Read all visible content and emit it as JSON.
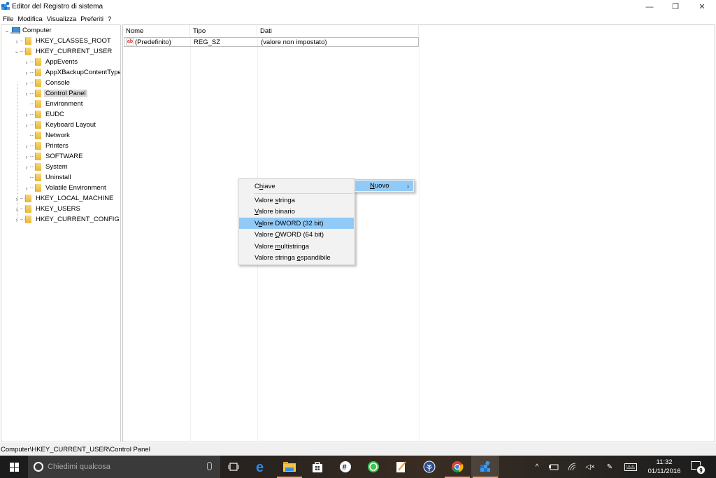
{
  "window": {
    "title": "Editor del Registro di sistema",
    "minimize_label": "—",
    "maximize_label": "❐",
    "close_label": "✕"
  },
  "menubar": {
    "items": [
      "File",
      "Modifica",
      "Visualizza",
      "Preferiti",
      "?"
    ]
  },
  "tree": {
    "root": "Computer",
    "hives": [
      {
        "label": "HKEY_CLASSES_ROOT",
        "expanded": false
      },
      {
        "label": "HKEY_CURRENT_USER",
        "expanded": true
      },
      {
        "label": "HKEY_LOCAL_MACHINE",
        "expanded": false
      },
      {
        "label": "HKEY_USERS",
        "expanded": false
      },
      {
        "label": "HKEY_CURRENT_CONFIG",
        "expanded": false
      }
    ],
    "hkcu_children": [
      {
        "label": "AppEvents",
        "has_children": true
      },
      {
        "label": "AppXBackupContentType",
        "has_children": true
      },
      {
        "label": "Console",
        "has_children": true
      },
      {
        "label": "Control Panel",
        "has_children": true,
        "selected": true
      },
      {
        "label": "Environment",
        "has_children": false
      },
      {
        "label": "EUDC",
        "has_children": true
      },
      {
        "label": "Keyboard Layout",
        "has_children": true
      },
      {
        "label": "Network",
        "has_children": false
      },
      {
        "label": "Printers",
        "has_children": true
      },
      {
        "label": "SOFTWARE",
        "has_children": true
      },
      {
        "label": "System",
        "has_children": true
      },
      {
        "label": "Uninstall",
        "has_children": false
      },
      {
        "label": "Volatile Environment",
        "has_children": true
      }
    ]
  },
  "list": {
    "columns": [
      "Nome",
      "Tipo",
      "Dati"
    ],
    "rows": [
      {
        "icon": "ab",
        "name": "(Predefinito)",
        "type": "REG_SZ",
        "data": "(valore non impostato)"
      }
    ]
  },
  "context_menu": {
    "parent_item": "Nuovo",
    "parent_accel": "N",
    "items": [
      {
        "label": "Chiave",
        "accel_index": 1
      },
      {
        "label": "Valore stringa",
        "accel_index": 7
      },
      {
        "label": "Valore binario",
        "accel_index": 0
      },
      {
        "label": "Valore DWORD (32 bit)",
        "accel_index": 1,
        "highlighted": true
      },
      {
        "label": "Valore QWORD (64 bit)",
        "accel_index": 7
      },
      {
        "label": "Valore multistringa",
        "accel_index": 7
      },
      {
        "label": "Valore stringa espandibile",
        "accel_index": 15
      }
    ]
  },
  "statusbar": {
    "path": "Computer\\HKEY_CURRENT_USER\\Control Panel"
  },
  "taskbar": {
    "search_placeholder": "Chiedimi qualcosa",
    "apps": [
      "task-view",
      "edge",
      "file-explorer",
      "store",
      "slack",
      "whatsapp",
      "notepad",
      "app-tree",
      "chrome",
      "regedit"
    ],
    "clock_time": "11:32",
    "clock_date": "01/11/2016",
    "notification_count": "9"
  },
  "colors": {
    "menu_highlight": "#91c9f7",
    "tree_selected": "#d9d9d9",
    "taskbar_bg": "#1b1b1b"
  }
}
